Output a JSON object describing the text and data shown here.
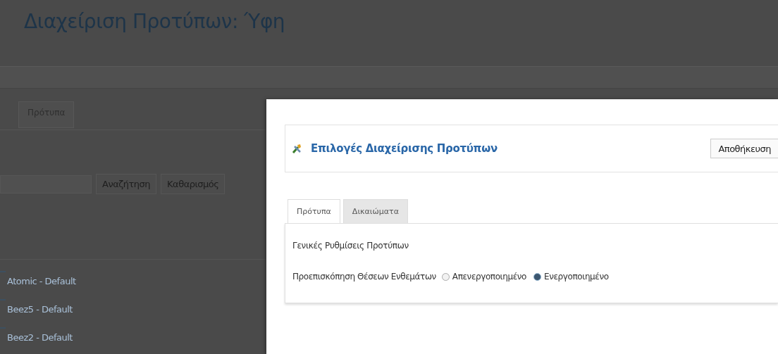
{
  "page": {
    "title": "Διαχείριση Προτύπων: Ύφη",
    "tabs": [
      {
        "label": "Πρότυπα"
      }
    ],
    "search": {
      "buttons": [
        "Αναζήτηση",
        "Καθαρισμός"
      ]
    },
    "items": [
      {
        "label": "Atomic - Default"
      },
      {
        "label": "Beez5 - Default"
      },
      {
        "label": "Beez2 - Default"
      }
    ]
  },
  "modal": {
    "title": "Επιλογές Διαχείρισης Προτύπων",
    "save_button": "Αποθήκευση",
    "tabs": [
      {
        "label": "Πρότυπα",
        "selected": true
      },
      {
        "label": "Δικαιώματα",
        "selected": false
      }
    ],
    "section_title": "Γενικές Ρυθμίσεις Προτύπων",
    "field": {
      "label": "Προεπισκόπηση Θέσεων Ενθεμάτων",
      "options": [
        {
          "label": "Απενεργοποιημένο",
          "selected": false
        },
        {
          "label": "Ενεργοποιημένο",
          "selected": true
        }
      ]
    }
  }
}
